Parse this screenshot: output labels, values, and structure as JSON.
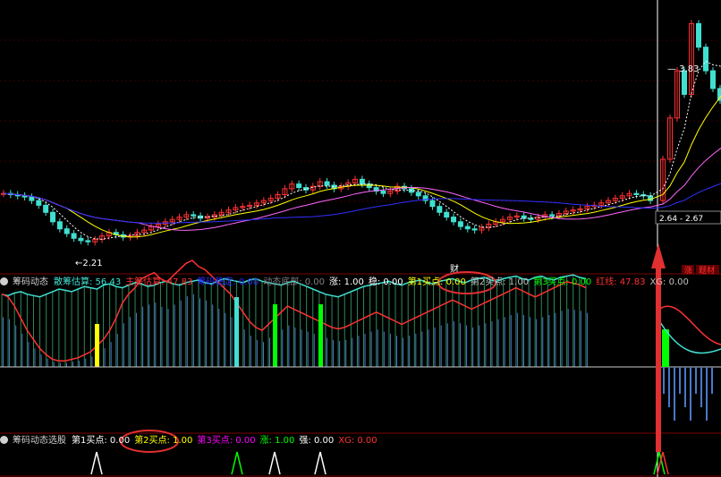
{
  "colors": {
    "background": "#000000",
    "red": "#ff3232",
    "cyan": "#40e0d0",
    "blue_line": "#2a2aff",
    "white": "#ffffff",
    "yellow": "#ffff00",
    "green": "#00ff00",
    "magenta": "#ff00ff",
    "grid_red": "#3a0000",
    "annotation_red": "#e03030"
  },
  "price_panel": {
    "low_label": "2.21",
    "high_label": "3.83",
    "range_label": "2.64 - 2.67",
    "finance_marker": "财",
    "badges": [
      "涨",
      "题材"
    ],
    "annotation_arrow": "up-arrow"
  },
  "panel1": {
    "title": "筹码动态",
    "fields": [
      {
        "label": "散筹估算:",
        "value": "56.43",
        "color": "#40e0d0"
      },
      {
        "label": "主筹估算:",
        "value": "47.83",
        "color": "#ff3232"
      },
      {
        "label": "筹码稳定:",
        "value": "0.00",
        "color": "#2a2aff"
      },
      {
        "label": "动态底部:",
        "value": "0.00",
        "color": "#808080"
      },
      {
        "label": "涨:",
        "value": "1.00",
        "color": "#ffffff"
      },
      {
        "label": "稳:",
        "value": "0.00",
        "color": "#ffffff"
      },
      {
        "label": "第1买点:",
        "value": "0.00",
        "color": "#ffff00"
      },
      {
        "label": "第2买点:",
        "value": "1.00",
        "color": "#c0c0c0"
      },
      {
        "label": "第3买点:",
        "value": "0.00",
        "color": "#00ff00"
      },
      {
        "label": "红线:",
        "value": "47.83",
        "color": "#ff3232"
      },
      {
        "label": "XG:",
        "value": "0.00",
        "color": "#c0c0c0"
      }
    ],
    "circled_field": "第2买点: 1.00"
  },
  "panel2": {
    "title": "筹码动态选股",
    "fields": [
      {
        "label": "第1买点:",
        "value": "0.00",
        "color": "#ffffff"
      },
      {
        "label": "第2买点:",
        "value": "1.00",
        "color": "#ffff00"
      },
      {
        "label": "第3买点:",
        "value": "0.00",
        "color": "#ff00ff"
      },
      {
        "label": "涨:",
        "value": "1.00",
        "color": "#00ff00"
      },
      {
        "label": "强:",
        "value": "0.00",
        "color": "#ffffff"
      },
      {
        "label": "XG:",
        "value": "0.00",
        "color": "#ff3232"
      }
    ],
    "circled_field": "第2买点: 1.00"
  },
  "chart_data": [
    {
      "type": "candlestick",
      "title": "",
      "ylim": [
        2.1,
        4.3
      ],
      "ma_lines": [
        "white",
        "yellow",
        "magenta",
        "blue"
      ],
      "marked_low": 2.21,
      "marked_high": 3.83,
      "close": [
        2.66,
        2.65,
        2.64,
        2.63,
        2.6,
        2.56,
        2.5,
        2.42,
        2.36,
        2.32,
        2.28,
        2.26,
        2.25,
        2.27,
        2.3,
        2.33,
        2.31,
        2.29,
        2.3,
        2.33,
        2.35,
        2.38,
        2.4,
        2.42,
        2.44,
        2.46,
        2.48,
        2.47,
        2.45,
        2.46,
        2.48,
        2.5,
        2.52,
        2.54,
        2.55,
        2.56,
        2.58,
        2.6,
        2.62,
        2.65,
        2.7,
        2.74,
        2.71,
        2.69,
        2.72,
        2.76,
        2.73,
        2.7,
        2.72,
        2.75,
        2.78,
        2.74,
        2.71,
        2.68,
        2.66,
        2.68,
        2.72,
        2.7,
        2.67,
        2.64,
        2.6,
        2.55,
        2.5,
        2.46,
        2.42,
        2.38,
        2.36,
        2.35,
        2.37,
        2.4,
        2.42,
        2.44,
        2.46,
        2.47,
        2.45,
        2.44,
        2.46,
        2.48,
        2.47,
        2.49,
        2.51,
        2.52,
        2.53,
        2.55,
        2.56,
        2.58,
        2.6,
        2.62,
        2.64,
        2.66,
        2.65,
        2.64,
        2.6,
        2.95,
        3.3,
        3.7,
        3.5,
        4.1,
        3.9,
        3.7,
        3.55,
        3.45,
        3.4
      ]
    },
    {
      "type": "bar",
      "title": "筹码动态",
      "series": [
        {
          "name": "散筹估算",
          "values": [
            56,
            55,
            57,
            58,
            56,
            55,
            54,
            56,
            58,
            60,
            59,
            58,
            60,
            62,
            61,
            60,
            63,
            64,
            62,
            61,
            63,
            65,
            64,
            62,
            63,
            65,
            66,
            64,
            63,
            65,
            66,
            67,
            65,
            64,
            66,
            68,
            67,
            66,
            65,
            67,
            68,
            66,
            65,
            64,
            63,
            65,
            66,
            64,
            62,
            60,
            58,
            56,
            55,
            54,
            56,
            58,
            60,
            62,
            63,
            64,
            65,
            66,
            64,
            63,
            65,
            66,
            67,
            65,
            64,
            66,
            67,
            68,
            66,
            65,
            67,
            68,
            69,
            67,
            66,
            68,
            69,
            70,
            68,
            67,
            69,
            70,
            68,
            67,
            69,
            70,
            71,
            69,
            68,
            40,
            30,
            25,
            20,
            22,
            25,
            28,
            30,
            32,
            35
          ]
        },
        {
          "name": "主筹估算",
          "values": [
            48,
            46,
            40,
            32,
            24,
            18,
            12,
            8,
            5,
            4,
            4,
            5,
            6,
            8,
            10,
            14,
            18,
            24,
            32,
            42,
            48,
            52,
            58,
            60,
            62,
            58,
            56,
            60,
            64,
            68,
            70,
            66,
            64,
            60,
            56,
            52,
            48,
            42,
            36,
            30,
            26,
            24,
            28,
            32,
            36,
            40,
            38,
            36,
            34,
            32,
            30,
            28,
            26,
            25,
            26,
            28,
            30,
            32,
            34,
            36,
            34,
            32,
            30,
            28,
            30,
            32,
            34,
            36,
            38,
            40,
            42,
            44,
            42,
            40,
            38,
            40,
            42,
            44,
            46,
            48,
            50,
            52,
            50,
            48,
            46,
            48,
            50,
            52,
            54,
            56,
            55,
            54,
            52,
            60,
            58,
            52,
            46,
            40,
            36,
            32,
            30,
            28,
            27
          ]
        }
      ],
      "markers": [
        {
          "name": "第1买点",
          "color": "yellow"
        },
        {
          "name": "第2买点",
          "color": "cyan"
        },
        {
          "name": "第3买点",
          "color": "green"
        }
      ]
    },
    {
      "type": "bar",
      "title": "筹码动态选股",
      "signals": [
        "白色三角",
        "绿色三角"
      ]
    }
  ]
}
